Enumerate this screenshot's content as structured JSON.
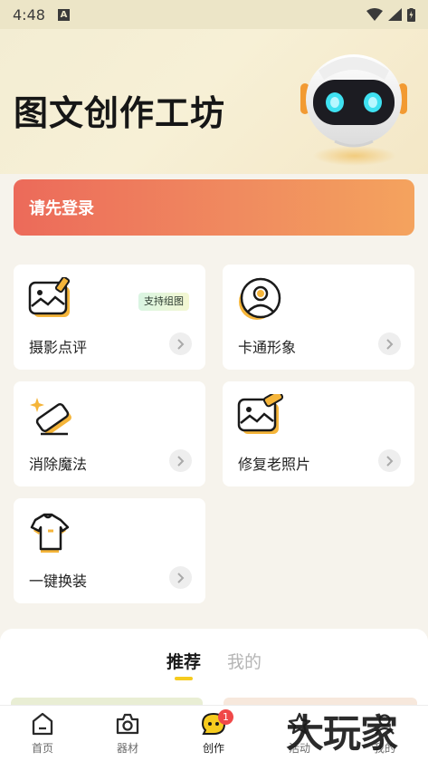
{
  "status_bar": {
    "time": "4:48",
    "app_indicator": "A",
    "icons": [
      "wifi-icon",
      "signal-icon",
      "battery-icon"
    ]
  },
  "header": {
    "title": "图文创作工坊",
    "mascot": "robot-mascot"
  },
  "login_banner": {
    "label": "请先登录",
    "gradient": [
      "#ec6a5a",
      "#f4a35e"
    ]
  },
  "tools": [
    {
      "label": "摄影点评",
      "icon": "photo-review-icon",
      "badge": "支持组图"
    },
    {
      "label": "卡通形象",
      "icon": "cartoon-avatar-icon"
    },
    {
      "label": "消除魔法",
      "icon": "eraser-magic-icon"
    },
    {
      "label": "修复老照片",
      "icon": "photo-repair-icon"
    },
    {
      "label": "一键换装",
      "icon": "outfit-change-icon"
    }
  ],
  "feed_tabs": [
    {
      "label": "推荐",
      "active": true
    },
    {
      "label": "我的",
      "active": false
    }
  ],
  "bottom_nav": [
    {
      "label": "首页",
      "icon": "home-icon"
    },
    {
      "label": "器材",
      "icon": "camera-icon"
    },
    {
      "label": "创作",
      "icon": "create-icon",
      "badge": "1",
      "active": true
    },
    {
      "label": "活动",
      "icon": "activity-icon"
    },
    {
      "label": "我的",
      "icon": "profile-icon"
    }
  ],
  "watermark": "大玩家",
  "colors": {
    "accent_yellow": "#f6cb1f",
    "badge_red": "#f04848",
    "icon_orange": "#f5b53a"
  }
}
